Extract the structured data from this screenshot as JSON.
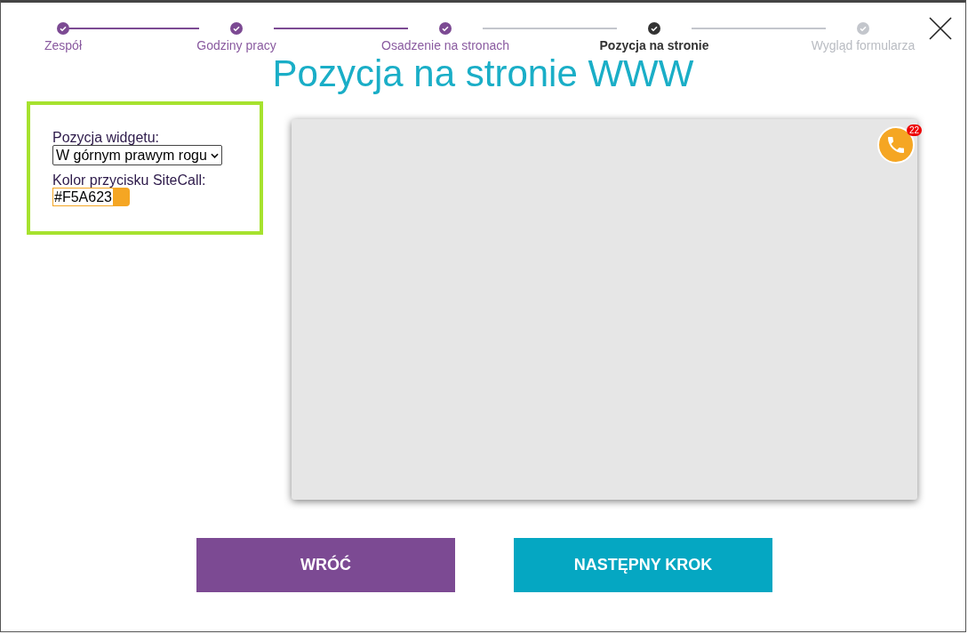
{
  "steps": [
    {
      "label": "Zespół",
      "done": true,
      "selected": false
    },
    {
      "label": "Godziny pracy",
      "done": true,
      "selected": false
    },
    {
      "label": "Osadzenie na stronach",
      "done": true,
      "selected": false
    },
    {
      "label": "Pozycja na stronie",
      "done": false,
      "selected": true
    },
    {
      "label": "Wygląd formularza",
      "done": false,
      "selected": false
    }
  ],
  "title": "Pozycja na stronie WWW",
  "settings": {
    "position_label": "Pozycja widgetu:",
    "position_value": "W górnym prawym rogu",
    "color_label": "Kolor przycisku SiteCall:",
    "color_value": "#F5A623"
  },
  "preview": {
    "badge": "22"
  },
  "buttons": [
    {
      "label": "WRÓĆ",
      "kind": "back"
    },
    {
      "label": "NASTĘPNY KROK",
      "kind": "next"
    }
  ]
}
